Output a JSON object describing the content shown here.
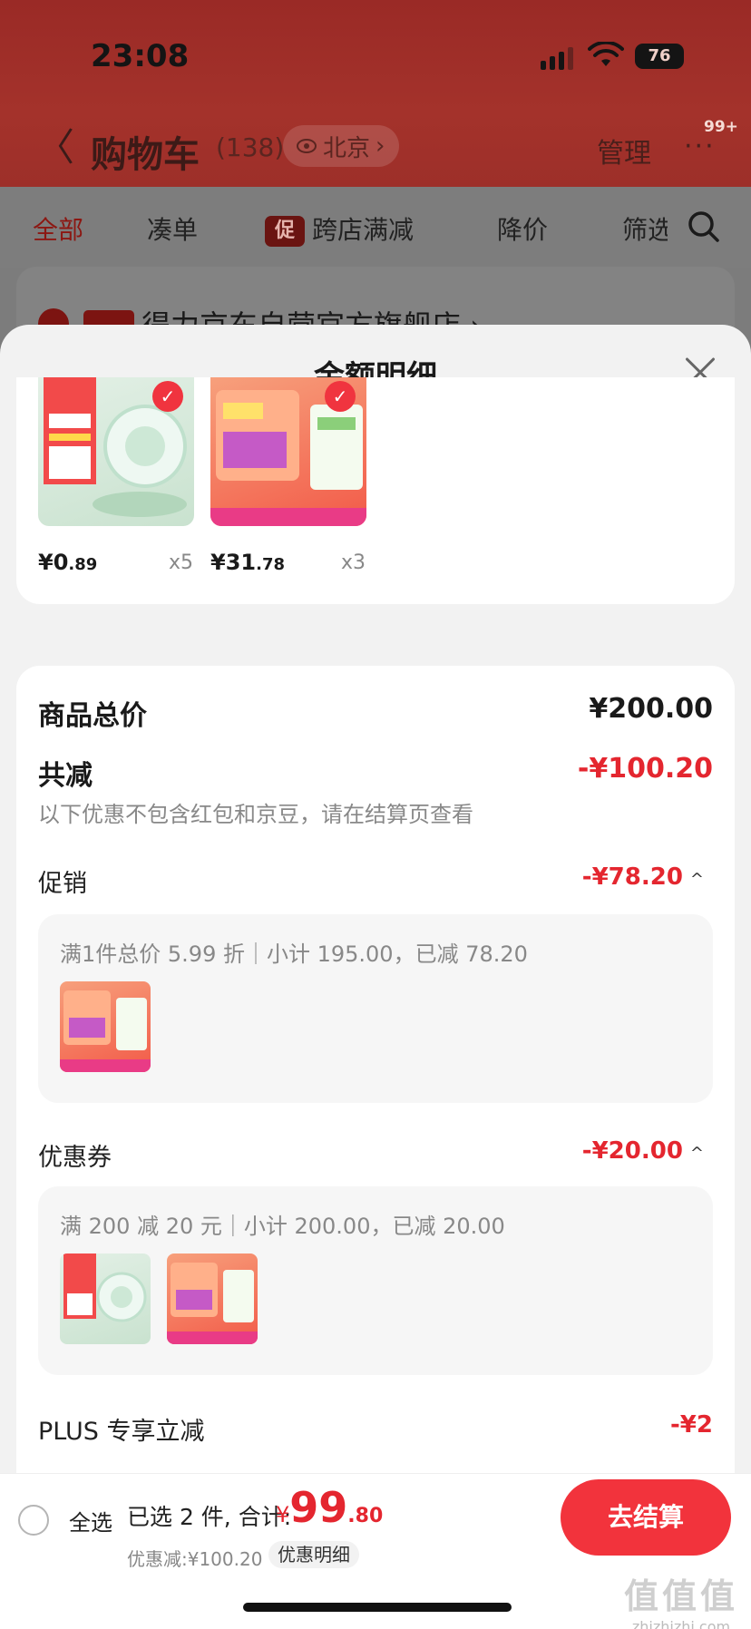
{
  "status_bar": {
    "time": "23:08",
    "battery": "76"
  },
  "nav": {
    "back": "〈",
    "title": "购物车",
    "count": "(138)",
    "location": "北京",
    "manage": "管理",
    "more": "···",
    "badge": "99+"
  },
  "tabs": {
    "all": "全部",
    "bundle": "凑单",
    "promo_badge": "促",
    "cross_store": "跨店满减",
    "price_drop": "降价",
    "filter": "筛选"
  },
  "store": {
    "tag": "自营",
    "name": "得力京东自营官方旗舰店 ›"
  },
  "sheet": {
    "title": "金额明细"
  },
  "goods": [
    {
      "price_int": "¥0",
      "price_dec": ".89",
      "qty": "x5",
      "checked": "✓"
    },
    {
      "price_int": "¥31",
      "price_dec": ".78",
      "qty": "x3",
      "checked": "✓"
    }
  ],
  "summary": {
    "total_label": "商品总价",
    "total_value": "¥200.00",
    "reduce_label": "共减",
    "reduce_value": "-¥100.20",
    "note": "以下优惠不包含红包和京豆，请在结算页查看",
    "promo_label": "促销",
    "promo_value": "-¥78.20",
    "promo_desc": "满1件总价 5.99 折｜小计 195.00，已减 78.20",
    "coupon_label": "优惠券",
    "coupon_value": "-¥20.00",
    "coupon_desc": "满 200 减 20 元｜小计 200.00，已减 20.00",
    "plus_label": "PLUS 专享立减",
    "plus_value": "-¥2",
    "caret": "^"
  },
  "bottom": {
    "select_all": "全选",
    "selected": "已选 2 件, 合计:",
    "currency": "¥",
    "total_int": "99",
    "total_dec": ".80",
    "discount": "优惠减:¥100.20",
    "detail": "优惠明细",
    "checkout": "去结算"
  },
  "watermark": {
    "big": "值值值",
    "small": "zhizhizhi.com"
  },
  "colors": {
    "accent": "#e4262f",
    "checkout": "#f2333c",
    "header": "#9a2a26"
  }
}
